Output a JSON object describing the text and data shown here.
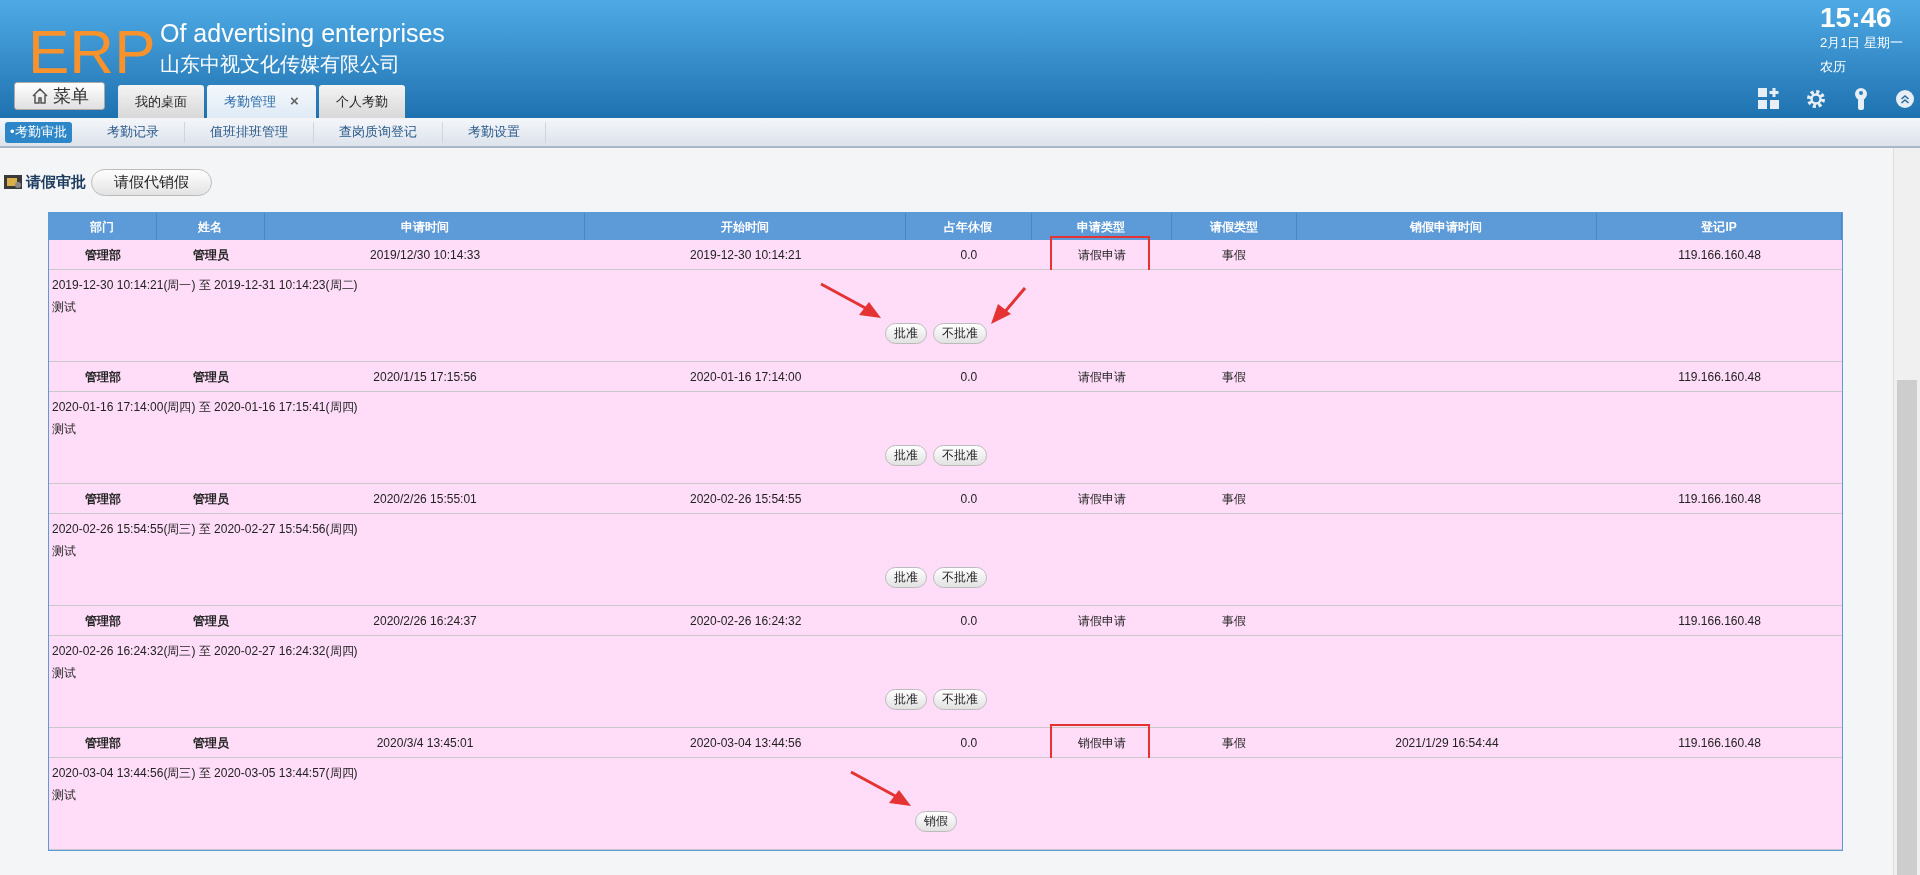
{
  "header": {
    "logo": "ERP",
    "title": "Of advertising enterprises",
    "company": "山东中视文化传媒有限公司",
    "time": "15:46",
    "date": "2月1日 星期一",
    "lunar": "农历"
  },
  "menu_button": "菜单",
  "tabs": [
    {
      "label": "我的桌面",
      "selected": false,
      "closable": false
    },
    {
      "label": "考勤管理",
      "selected": true,
      "closable": true,
      "close": "×"
    },
    {
      "label": "个人考勤",
      "selected": false,
      "closable": false
    }
  ],
  "subnav": [
    {
      "label": "•考勤审批",
      "selected": true
    },
    {
      "label": "考勤记录",
      "selected": false
    },
    {
      "label": "值班排班管理",
      "selected": false
    },
    {
      "label": "查岗质询登记",
      "selected": false
    },
    {
      "label": "考勤设置",
      "selected": false
    }
  ],
  "page_title": "请假审批",
  "page_button": "请假代销假",
  "table": {
    "columns": [
      "部门",
      "姓名",
      "申请时间",
      "开始时间",
      "占年休假",
      "申请类型",
      "请假类型",
      "销假申请时间",
      "登记IP"
    ],
    "records": [
      {
        "cells": [
          "管理部",
          "管理员",
          "2019/12/30 10:14:33",
          "2019-12-30 10:14:21",
          "0.0",
          "请假申请",
          "事假",
          "",
          "119.166.160.48"
        ],
        "type_marked": true,
        "period": "2019-12-30 10:14:21(周一) 至 2019-12-31 10:14:23(周二)",
        "note": "测试",
        "buttons": [
          {
            "label": "批准",
            "arrow_left": true,
            "arrow_right": false
          },
          {
            "label": "不批准",
            "arrow_left": false,
            "arrow_right": true
          }
        ]
      },
      {
        "cells": [
          "管理部",
          "管理员",
          "2020/1/15 17:15:56",
          "2020-01-16 17:14:00",
          "0.0",
          "请假申请",
          "事假",
          "",
          "119.166.160.48"
        ],
        "type_marked": false,
        "period": "2020-01-16 17:14:00(周四) 至 2020-01-16 17:15:41(周四)",
        "note": "测试",
        "buttons": [
          {
            "label": "批准",
            "arrow_left": false,
            "arrow_right": false
          },
          {
            "label": "不批准",
            "arrow_left": false,
            "arrow_right": false
          }
        ]
      },
      {
        "cells": [
          "管理部",
          "管理员",
          "2020/2/26 15:55:01",
          "2020-02-26 15:54:55",
          "0.0",
          "请假申请",
          "事假",
          "",
          "119.166.160.48"
        ],
        "type_marked": false,
        "period": "2020-02-26 15:54:55(周三) 至 2020-02-27 15:54:56(周四)",
        "note": "测试",
        "buttons": [
          {
            "label": "批准",
            "arrow_left": false,
            "arrow_right": false
          },
          {
            "label": "不批准",
            "arrow_left": false,
            "arrow_right": false
          }
        ]
      },
      {
        "cells": [
          "管理部",
          "管理员",
          "2020/2/26 16:24:37",
          "2020-02-26 16:24:32",
          "0.0",
          "请假申请",
          "事假",
          "",
          "119.166.160.48"
        ],
        "type_marked": false,
        "period": "2020-02-26 16:24:32(周三) 至 2020-02-27 16:24:32(周四)",
        "note": "测试",
        "buttons": [
          {
            "label": "批准",
            "arrow_left": false,
            "arrow_right": false
          },
          {
            "label": "不批准",
            "arrow_left": false,
            "arrow_right": false
          }
        ]
      },
      {
        "cells": [
          "管理部",
          "管理员",
          "2020/3/4 13:45:01",
          "2020-03-04 13:44:56",
          "0.0",
          "销假申请",
          "事假",
          "2021/1/29 16:54:44",
          "119.166.160.48"
        ],
        "type_marked": true,
        "period": "2020-03-04 13:44:56(周三) 至 2020-03-05 13:44:57(周四)",
        "note": "测试",
        "buttons": [
          {
            "label": "销假",
            "arrow_left": true,
            "arrow_right": false
          }
        ]
      }
    ]
  }
}
